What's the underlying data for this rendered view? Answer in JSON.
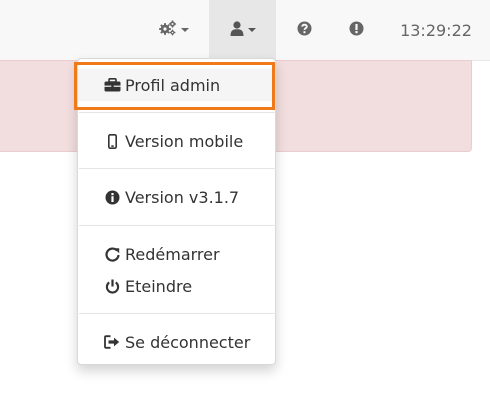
{
  "navbar": {
    "settings_icon": "cogs-icon",
    "user_icon": "user-icon",
    "help_icon": "question-circle-icon",
    "alert_icon": "exclamation-circle-icon",
    "clock": "13:29:22"
  },
  "user_menu": {
    "items": [
      {
        "label": "Profil admin",
        "icon": "briefcase-icon"
      },
      {
        "label": "Version mobile",
        "icon": "mobile-icon"
      },
      {
        "label": "Version v3.1.7",
        "icon": "info-circle-icon"
      },
      {
        "label": "Redémarrer",
        "icon": "refresh-icon"
      },
      {
        "label": "Eteindre",
        "icon": "power-off-icon"
      },
      {
        "label": "Se déconnecter",
        "icon": "sign-out-icon"
      }
    ]
  },
  "colors": {
    "highlight": "#f07a1a",
    "alert_background": "#f2dede",
    "navbar_background": "#f8f8f8"
  }
}
